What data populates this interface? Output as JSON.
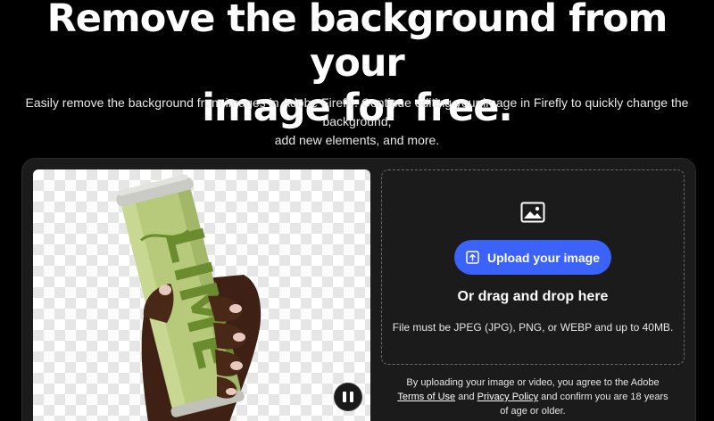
{
  "hero": {
    "title_line1": "Remove the background from your",
    "title_line2": "image for free.",
    "subtitle_line1": "Easily remove the background from images in Adobe Firefly. Continue editing your image in Firefly to quickly change the background,",
    "subtitle_line2": "add new elements, and more."
  },
  "preview": {
    "can_text": "LIME",
    "pause_icon": "pause-icon"
  },
  "upload": {
    "image_icon": "image-icon",
    "button_icon": "upload-icon",
    "button_label": "Upload your image",
    "drag_text": "Or drag and drop here",
    "requirements": "File must be JPEG (JPG), PNG, or WEBP and up to 40MB."
  },
  "legal": {
    "prefix": "By uploading your image or video, you agree to the Adobe ",
    "terms_link": "Terms of Use",
    "and": " and ",
    "privacy_link": "Privacy Policy",
    "suffix": " and confirm you are 18 years of age or older."
  },
  "colors": {
    "background": "#000000",
    "panel": "#1b1b1b",
    "accent": "#3b63fb",
    "can": "#b5c97a",
    "can_lettering": "#6a8c2f"
  }
}
